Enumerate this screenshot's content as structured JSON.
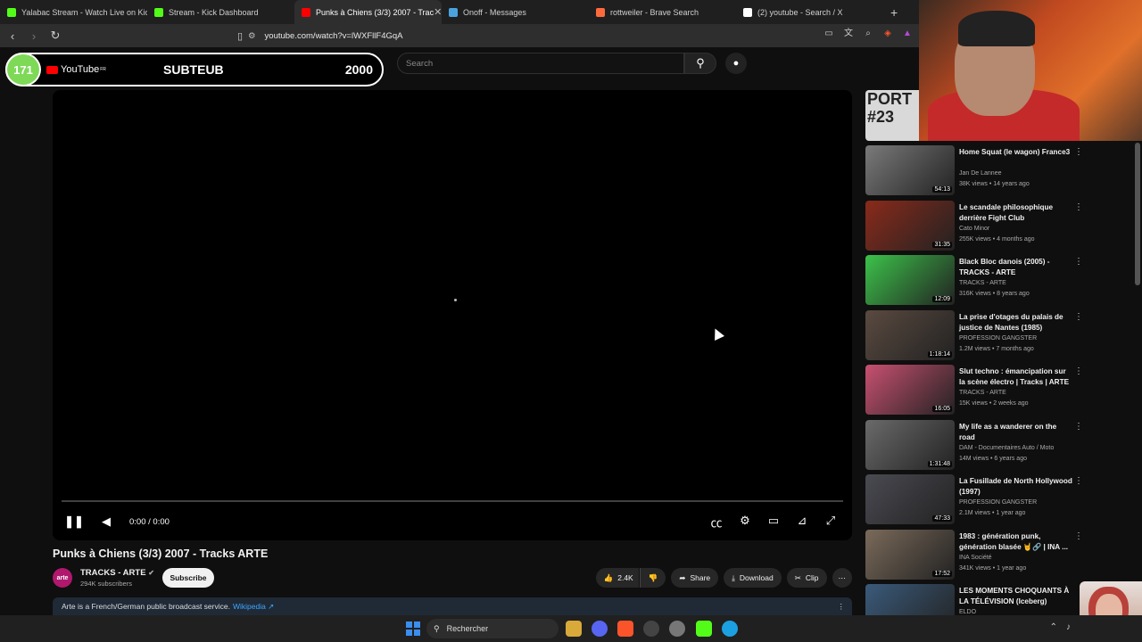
{
  "browser": {
    "tabs": [
      {
        "label": "Yalabac Stream - Watch Live on Kick",
        "color": "#53fc18"
      },
      {
        "label": "Stream - Kick Dashboard",
        "color": "#53fc18"
      },
      {
        "label": "Punks à Chiens (3/3) 2007 - Trac",
        "color": "#ff0000",
        "active": true
      },
      {
        "label": "Onoff - Messages",
        "color": "#4aa3df"
      },
      {
        "label": "rottweiler - Brave Search",
        "color": "#ff6a3d"
      },
      {
        "label": "(2) youtube - Search / X",
        "color": "#ffffff"
      }
    ],
    "url": "youtube.com/watch?v=lWXFllF4GqA",
    "new_tab": "+"
  },
  "overlay": {
    "count": "171",
    "logo_text": "YouTube",
    "logo_sup": "FR",
    "name": "SUBTEUB",
    "goal": "2000"
  },
  "youtube_header": {
    "search_placeholder": "Search"
  },
  "player": {
    "time": "0:00 / 0:00"
  },
  "video": {
    "title": "Punks à Chiens (3/3) 2007 - Tracks ARTE",
    "channel": "TRACKS - ARTE",
    "avatar_text": "arte",
    "subscribers": "294K subscribers",
    "subscribe_label": "Subscribe",
    "likes": "2.4K",
    "share_label": "Share",
    "download_label": "Download",
    "clip_label": "Clip",
    "info_text": "Arte is a French/German public broadcast service.",
    "info_link": "Wikipedia ↗"
  },
  "sidebar": {
    "first_thumb_text": "PORT #23",
    "items": [
      {
        "title": "Home Squat (le wagon) France3",
        "channel": "Jan De Lannee",
        "meta": "38K views • 14 years ago",
        "duration": "54:13",
        "thumb": "#7a7a7a"
      },
      {
        "title": "Le scandale philosophique derrière Fight Club",
        "channel": "Cato Minor",
        "meta": "255K views • 4 months ago",
        "duration": "31:35",
        "thumb": "#8a2a1a"
      },
      {
        "title": "Black Bloc danois (2005) - TRACKS - ARTE",
        "channel": "TRACKS - ARTE",
        "meta": "316K views • 8 years ago",
        "duration": "12:09",
        "thumb": "#3cc24a"
      },
      {
        "title": "La prise d'otages du palais de justice de Nantes (1985)",
        "channel": "PROFESSION GANGSTER",
        "meta": "1.2M views • 7 months ago",
        "duration": "1:18:14",
        "thumb": "#5a4a40"
      },
      {
        "title": "Slut techno : émancipation sur la scène électro | Tracks | ARTE",
        "channel": "TRACKS - ARTE",
        "meta": "15K views • 2 weeks ago",
        "duration": "16:05",
        "thumb": "#c85070"
      },
      {
        "title": "My life as a wanderer on the road",
        "channel": "DAM - Documentaires Auto / Moto",
        "meta": "14M views • 6 years ago",
        "duration": "1:31:48",
        "thumb": "#6a6a6a"
      },
      {
        "title": "La Fusillade de North Hollywood (1997)",
        "channel": "PROFESSION GANGSTER",
        "meta": "2.1M views • 1 year ago",
        "duration": "47:33",
        "thumb": "#4a4a52"
      },
      {
        "title": "1983 : génération punk, génération blasée 🤘🔗 | INA ...",
        "channel": "INA Société",
        "meta": "341K views • 1 year ago",
        "duration": "17:52",
        "thumb": "#7a6a5a"
      },
      {
        "title": "LES MOMENTS CHOQUANTS À LA TÉLÉVISION (Iceberg)",
        "channel": "ELDO",
        "meta": "",
        "duration": "",
        "thumb": "#3a5a7a"
      }
    ]
  },
  "taskbar": {
    "search_label": "Rechercher"
  }
}
